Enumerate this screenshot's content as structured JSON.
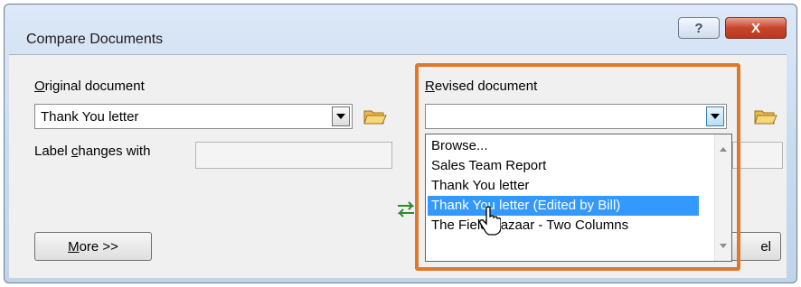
{
  "dialog": {
    "title": "Compare Documents",
    "help_label": "?",
    "close_label": "X"
  },
  "original": {
    "label_prefix": "",
    "label_accel": "O",
    "label_rest": "riginal document",
    "value": "Thank You letter",
    "label_changes_pre": "Label ",
    "label_changes_accel": "c",
    "label_changes_rest": "hanges with",
    "label_changes_value": ""
  },
  "revised": {
    "label_accel": "R",
    "label_rest": "evised document",
    "value": "",
    "options": [
      "Browse...",
      "Sales Team Report",
      "Thank You letter",
      "Thank You letter (Edited by Bill)",
      "The Field Bazaar - Two Columns"
    ],
    "selected_index": 3,
    "partial_label_right": "",
    "cancel_fragment": "el"
  },
  "buttons": {
    "more_accel": "M",
    "more_rest": "ore >>"
  },
  "colors": {
    "highlight": "#e0782a",
    "selection": "#3399ff",
    "close": "#c8442c"
  }
}
